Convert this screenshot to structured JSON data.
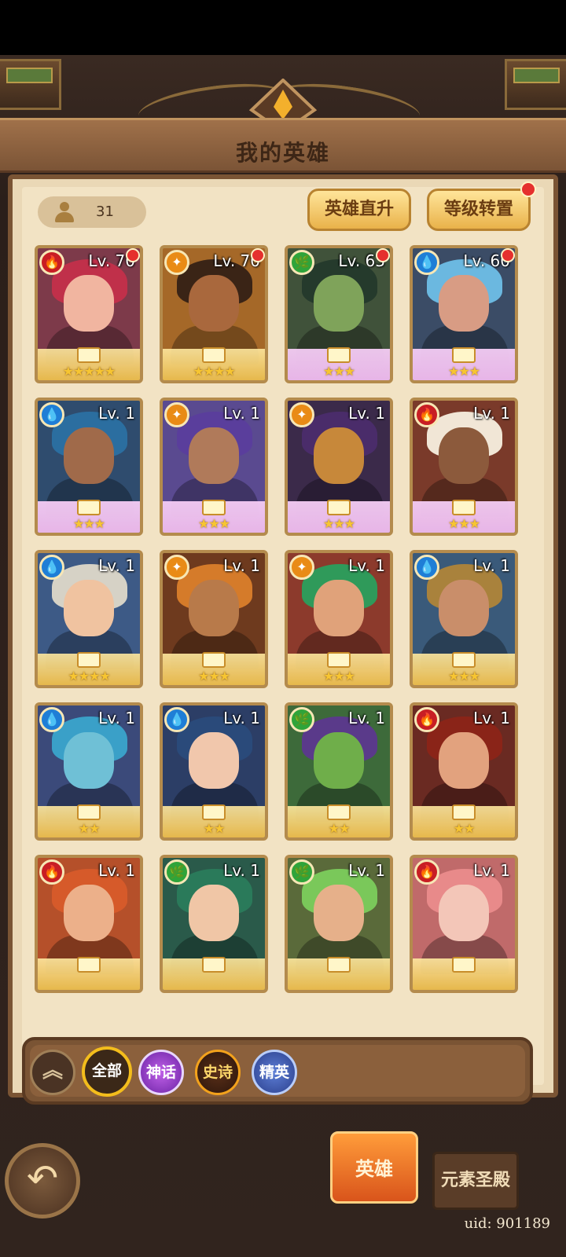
{
  "header": {
    "title": "我的英雄"
  },
  "hero_count": "31",
  "buttons": {
    "upgrade": "英雄直升",
    "transfer": "等级转置"
  },
  "heroes": [
    {
      "level": "Lv. 70",
      "element": "fire",
      "rarity": "epic",
      "stars": "★★★★★",
      "alert": true,
      "hair": "#c0304a",
      "skin": "#f1b5a0",
      "bg": "#7d3a4a"
    },
    {
      "level": "Lv. 70",
      "element": "light",
      "rarity": "epic",
      "stars": "★★★★",
      "alert": true,
      "hair": "#3a2416",
      "skin": "#a9683d",
      "bg": "#a56828"
    },
    {
      "level": "Lv. 63",
      "element": "nature",
      "rarity": "myth",
      "stars": "★★★",
      "alert": true,
      "hair": "#253a2c",
      "skin": "#7fa35a",
      "bg": "#40523a"
    },
    {
      "level": "Lv. 60",
      "element": "water",
      "rarity": "myth",
      "stars": "★★★",
      "alert": true,
      "hair": "#6bb8e0",
      "skin": "#d89c84",
      "bg": "#3b4c66"
    },
    {
      "level": "Lv. 1",
      "element": "water",
      "rarity": "myth",
      "stars": "★★★",
      "alert": false,
      "hair": "#2b6ea0",
      "skin": "#a06a4a",
      "bg": "#2f4c6e"
    },
    {
      "level": "Lv. 1",
      "element": "light",
      "rarity": "myth",
      "stars": "★★★",
      "alert": false,
      "hair": "#5a3e9c",
      "skin": "#b07a5a",
      "bg": "#5a4a90"
    },
    {
      "level": "Lv. 1",
      "element": "light",
      "rarity": "myth",
      "stars": "★★★",
      "alert": false,
      "hair": "#4a2c6a",
      "skin": "#c7883a",
      "bg": "#3b2a4a"
    },
    {
      "level": "Lv. 1",
      "element": "fire",
      "rarity": "myth",
      "stars": "★★★",
      "alert": false,
      "hair": "#f1e6d6",
      "skin": "#8c5a3c",
      "bg": "#7a3a2a"
    },
    {
      "level": "Lv. 1",
      "element": "water",
      "rarity": "epic",
      "stars": "★★★★",
      "alert": false,
      "hair": "#d6d2c6",
      "skin": "#f0c3a0",
      "bg": "#3d5a86"
    },
    {
      "level": "Lv. 1",
      "element": "light",
      "rarity": "epic",
      "stars": "★★★",
      "alert": false,
      "hair": "#d57b2a",
      "skin": "#b87a4a",
      "bg": "#6e3a1e"
    },
    {
      "level": "Lv. 1",
      "element": "light",
      "rarity": "epic",
      "stars": "★★★",
      "alert": false,
      "hair": "#2f9a5a",
      "skin": "#e0a27a",
      "bg": "#8c3a2c"
    },
    {
      "level": "Lv. 1",
      "element": "water",
      "rarity": "epic",
      "stars": "★★★",
      "alert": false,
      "hair": "#a9823c",
      "skin": "#c98e6a",
      "bg": "#3a5a7a"
    },
    {
      "level": "Lv. 1",
      "element": "water",
      "rarity": "epic",
      "stars": "★★",
      "alert": false,
      "hair": "#3aa0c8",
      "skin": "#6fc0d6",
      "bg": "#3b4a7a"
    },
    {
      "level": "Lv. 1",
      "element": "water",
      "rarity": "epic",
      "stars": "★★",
      "alert": false,
      "hair": "#2a4a7a",
      "skin": "#f1c7ac",
      "bg": "#2c3e66"
    },
    {
      "level": "Lv. 1",
      "element": "nature",
      "rarity": "epic",
      "stars": "★★",
      "alert": false,
      "hair": "#5a3a8a",
      "skin": "#6fae4a",
      "bg": "#3d6a3a"
    },
    {
      "level": "Lv. 1",
      "element": "fire",
      "rarity": "epic",
      "stars": "★★",
      "alert": false,
      "hair": "#8a2418",
      "skin": "#e2a27e",
      "bg": "#6a2a22"
    },
    {
      "level": "Lv. 1",
      "element": "fire",
      "rarity": "epic",
      "stars": "",
      "alert": false,
      "hair": "#d65a2a",
      "skin": "#ecb08a",
      "bg": "#b5502a"
    },
    {
      "level": "Lv. 1",
      "element": "nature",
      "rarity": "epic",
      "stars": "",
      "alert": false,
      "hair": "#2a7a5a",
      "skin": "#f0c6a6",
      "bg": "#2a5a4a"
    },
    {
      "level": "Lv. 1",
      "element": "nature",
      "rarity": "epic",
      "stars": "",
      "alert": false,
      "hair": "#7ac85a",
      "skin": "#e6b08a",
      "bg": "#5a6a3a"
    },
    {
      "level": "Lv. 1",
      "element": "fire",
      "rarity": "epic",
      "stars": "",
      "alert": false,
      "hair": "#e88a8a",
      "skin": "#f3c6b8",
      "bg": "#c06a6a"
    }
  ],
  "filters": {
    "collapse": "︽",
    "all": "全部",
    "myth": "神话",
    "epic": "史诗",
    "elite": "精英"
  },
  "nav": {
    "back": "↶",
    "heroes": "英雄",
    "temple": "元素圣殿"
  },
  "uid": "uid: 901189",
  "colors": {
    "fire": "#c81e24",
    "water": "#1f7ed6",
    "nature": "#2fa43a",
    "light": "#e98b16",
    "accent_gold": "#f3bd1c"
  }
}
